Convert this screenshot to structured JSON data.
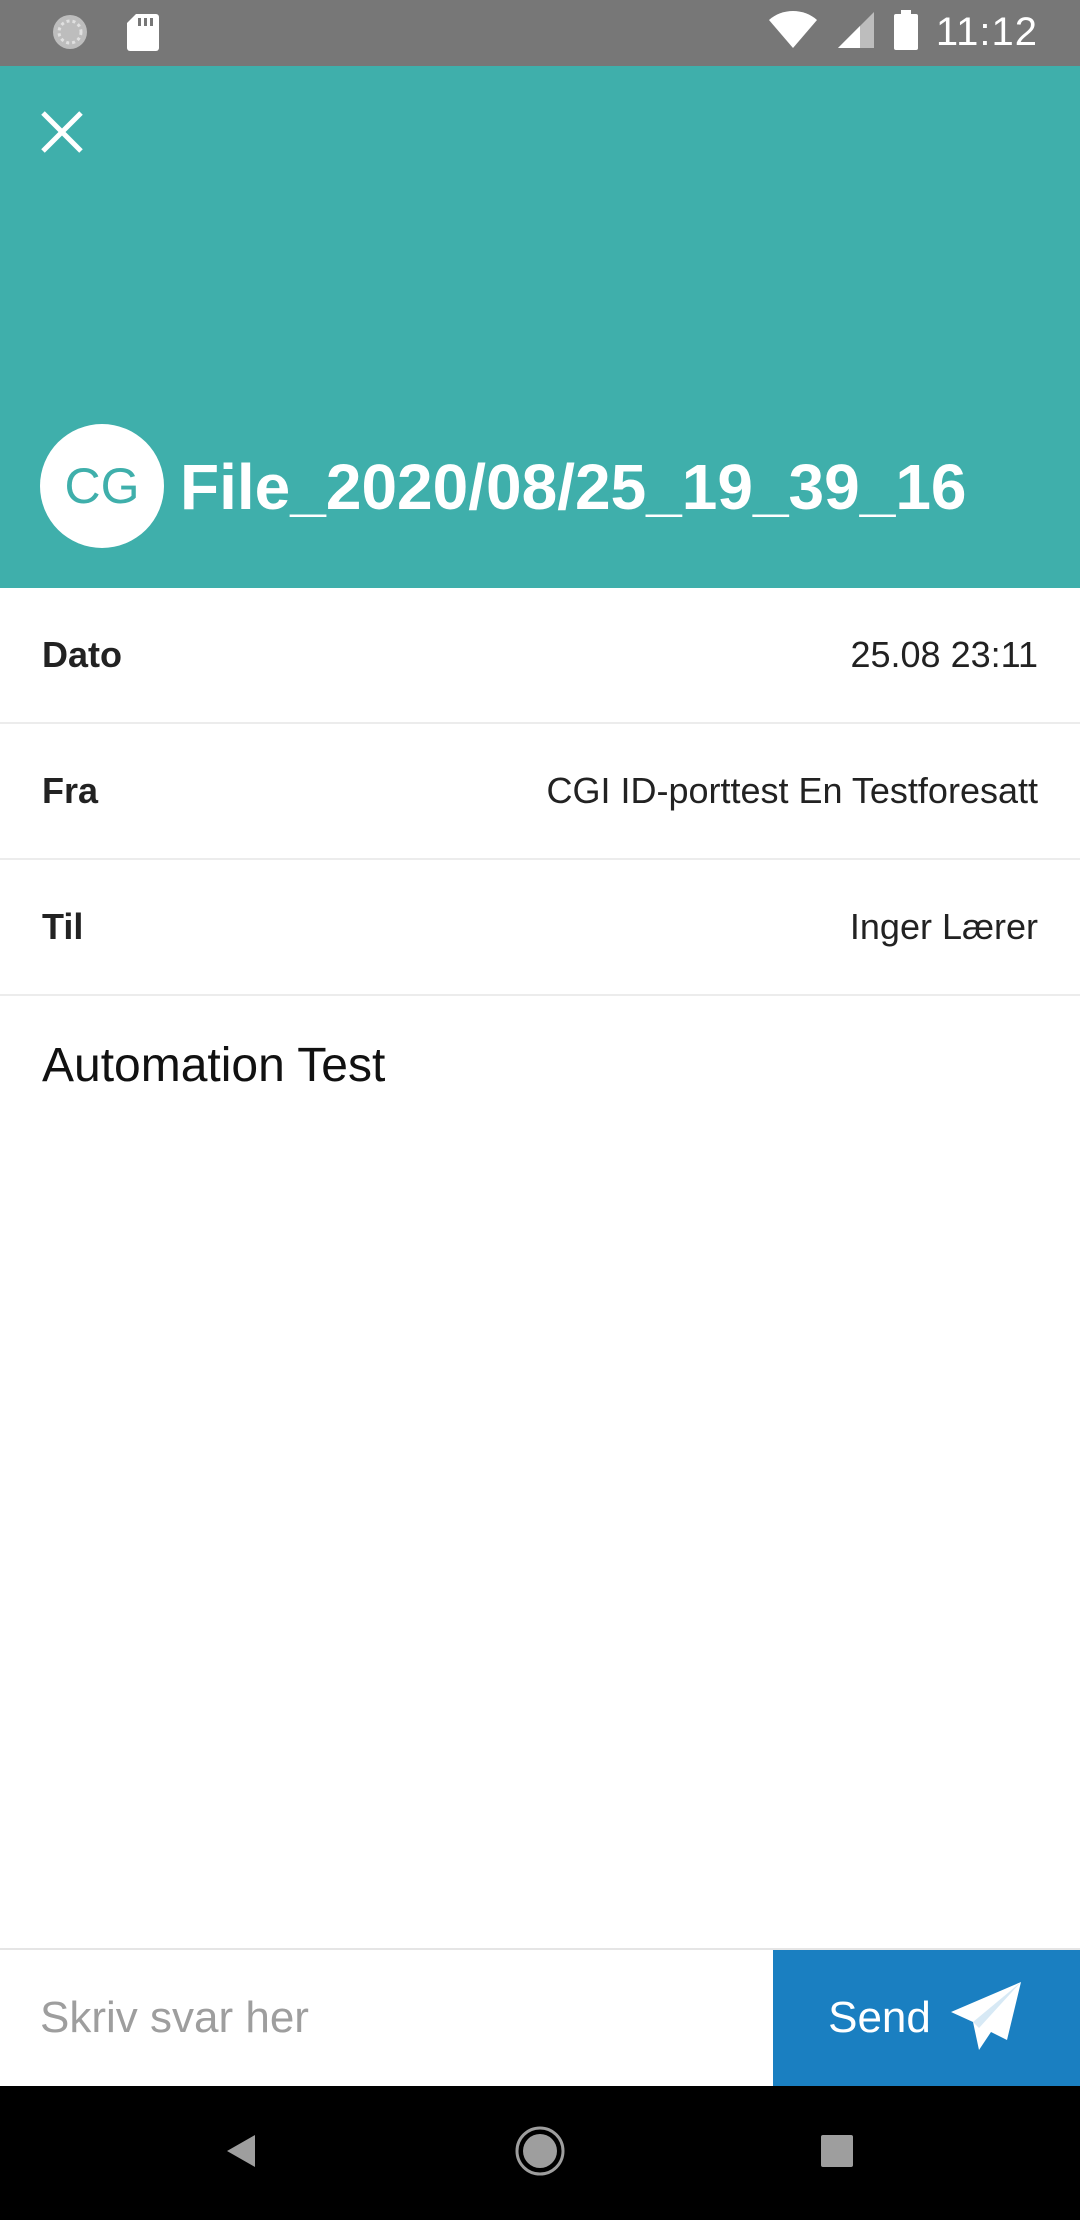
{
  "status_bar": {
    "time": "11:12",
    "left_icons": [
      "sync-icon",
      "sd-card-icon"
    ],
    "right_icons": [
      "wifi-icon",
      "signal-icon",
      "battery-icon"
    ]
  },
  "header": {
    "background": "#3fafab",
    "avatar_initials": "CG",
    "title": "File_2020/08/25_19_39_16"
  },
  "meta": [
    {
      "label": "Dato",
      "value": "25.08 23:11"
    },
    {
      "label": "Fra",
      "value": "CGI ID-porttest En Testforesatt"
    },
    {
      "label": "Til",
      "value": "Inger Lærer"
    }
  ],
  "message": {
    "body": "Automation Test"
  },
  "reply": {
    "placeholder": "Skriv svar her",
    "value": "",
    "send_label": "Send",
    "send_color": "#1a7fc1"
  },
  "nav_bar": {
    "buttons": [
      "back-icon",
      "home-icon",
      "recents-icon"
    ]
  }
}
